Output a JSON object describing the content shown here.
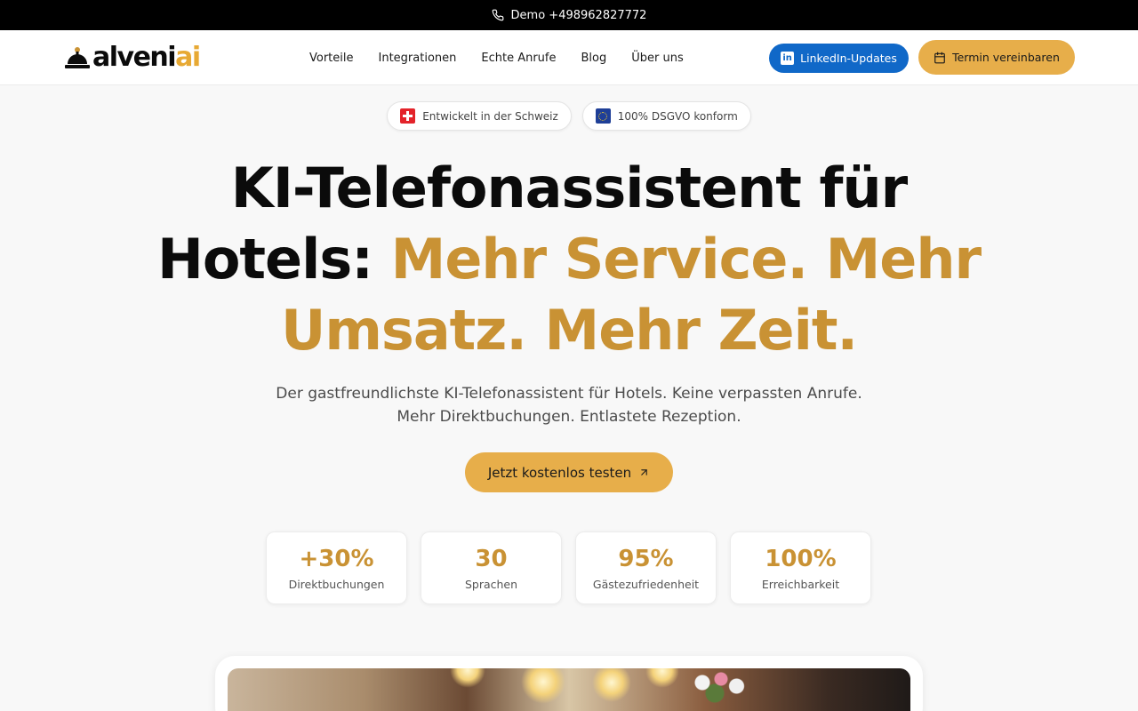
{
  "topbar": {
    "demo_text": "Demo +498962827772",
    "icon": "phone-icon"
  },
  "header": {
    "logo": {
      "text_dark": "alveni",
      "text_gold": "ai",
      "icon": "reception-bell-icon"
    },
    "nav": [
      {
        "label": "Vorteile"
      },
      {
        "label": "Integrationen"
      },
      {
        "label": "Echte Anrufe"
      },
      {
        "label": "Blog"
      },
      {
        "label": "Über uns"
      }
    ],
    "linkedin_button": {
      "label": "LinkedIn-Updates",
      "icon": "linkedin-icon",
      "color": "#1068c8"
    },
    "termin_button": {
      "label": "Termin vereinbaren",
      "icon": "calendar-icon",
      "color": "#e7ae4a"
    }
  },
  "badges": [
    {
      "label": "Entwickelt in der Schweiz",
      "icon": "swiss-flag-icon"
    },
    {
      "label": "100% DSGVO konform",
      "icon": "eu-flag-icon"
    }
  ],
  "hero": {
    "title_dark": "KI-Telefonassistent für Hotels:",
    "title_gold": "Mehr Service. Mehr Umsatz. Mehr Zeit.",
    "subtitle_line1": "Der gastfreundlichste KI-Telefonassistent für Hotels. Keine verpassten Anrufe.",
    "subtitle_line2": "Mehr Direktbuchungen. Entlastete Rezeption.",
    "cta_label": "Jetzt kostenlos testen",
    "cta_icon": "arrow-up-right-icon"
  },
  "stats": [
    {
      "value": "+30%",
      "label": "Direktbuchungen"
    },
    {
      "value": "30",
      "label": "Sprachen"
    },
    {
      "value": "95%",
      "label": "Gästezufriedenheit"
    },
    {
      "value": "100%",
      "label": "Erreichbarkeit"
    }
  ],
  "colors": {
    "accent": "#c99234",
    "button_gold": "#e7ae4a",
    "topbar": "#000000"
  }
}
